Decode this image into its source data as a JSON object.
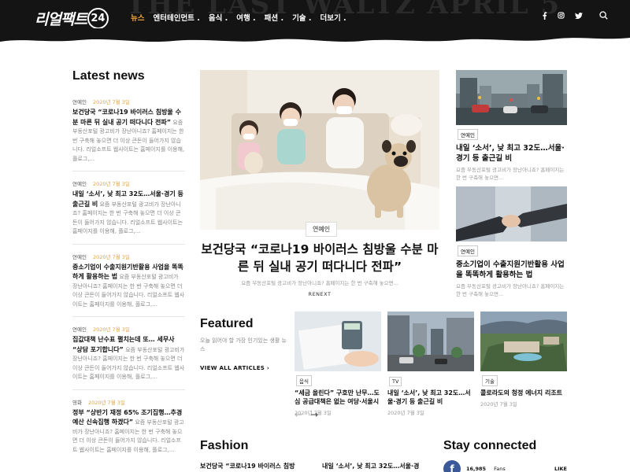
{
  "header": {
    "logo_text": "리얼팩트",
    "logo_num": "24",
    "bg_text": "THE LAST WALTZ APRIL 5",
    "nav": [
      "뉴스",
      "엔터테인먼트 .",
      "음식 .",
      "여행 .",
      "패션 .",
      "기술 .",
      "더보기 ."
    ],
    "active_nav": 0,
    "social_icons": [
      "facebook-icon",
      "instagram-icon",
      "twitter-icon",
      "search-icon"
    ]
  },
  "latest": {
    "title": "Latest news",
    "items": [
      {
        "category": "연예인",
        "date": "2020년 7월 3일",
        "title": "보건당국 “코로나19 바이러스 침방울 수분 마른 뒤 실내 공기 떠다니다 전파”",
        "excerpt": "요즘 부동산포털 광고비가 장난아니죠? 홈페이지는 한 번 구축해 놓으면 더 이상 큰돈이 들어가지 않습니다. 리얼소프트 웹사이트는 홈페이지를 이용해, 플로그,..."
      },
      {
        "category": "연예인",
        "date": "2020년 7월 3일",
        "title": "내일 ‘소서’, 낮 최고 32도…서울·경기 등 출근길 비",
        "excerpt": "요즘 부동산포털 광고비가 장난아니죠? 홈페이지는 한 번 구축해 놓으면 더 이상 큰돈이 들어가지 않습니다. 리얼소프트 웹사이트는 홈페이지를 이용해, 플로그,..."
      },
      {
        "category": "연예인",
        "date": "2020년 7월 3일",
        "title": "중소기업이 수출지원기반활용 사업을 똑똑하게 활용하는 법",
        "excerpt": "요즘 부동산포털 광고비가 장난아니죠? 홈페이지는 한 번 구축해 놓으면 더 이상 큰돈이 들어가지 않습니다. 리얼소프트 웹사이트는 홈페이지를 이용해, 플로그,..."
      },
      {
        "category": "연예인",
        "date": "2020년 7월 3일",
        "title": "집값대책 난수표 펼치는데 또… 세무사 “상담 포기합니다”",
        "excerpt": "요즘 부동산포털 광고비가 장난아니죠? 홈페이지는 한 번 구축해 놓으면 더 이상 큰돈이 들어가지 않습니다. 리얼소프트 웹사이트는 홈페이지를 이용해, 플로그,..."
      },
      {
        "category": "영화",
        "date": "2020년 7월 3일",
        "title": "정부 “상반기 재정 65% 조기집행…추경예산 신속집행 하겠다”",
        "excerpt": "요즘 부동산포털 광고비가 장난아니죠? 홈페이지는 한 번 구축해 놓으면 더 이상 큰돈이 들어가지 않습니다. 리얼소프트 웹사이트는 홈페이지를 이용해, 플로그,..."
      }
    ]
  },
  "hero": {
    "category": "연예인",
    "title": "보건당국 “코로나19 바이러스 침방울 수분 마른 뒤 실내 공기 떠다니다 전파”",
    "excerpt": "요즘 부동산포털 광고비가 장난아니죠? 홈페이지는 한 번 구축해 놓으면...",
    "source": "RENEXT"
  },
  "right_cards": [
    {
      "category": "연예인",
      "title": "내일 ‘소서’, 낮 최고 32도…서울·경기 등 출근길 비",
      "excerpt": "요즘 부동산포털 광고비가 장난아니죠? 홈페이지는 한 번 구축해 놓으면..."
    },
    {
      "category": "연예인",
      "title": "중소기업이 수출지원기반활용 사업을 똑똑하게 활용하는 법",
      "excerpt": "요즘 부동산포털 광고비가 장난아니죠? 홈페이지는 한 번 구축해 놓으면..."
    }
  ],
  "featured": {
    "title": "Featured",
    "description": "오늘 읽어야 할 가장 인기있는 생활 뉴스",
    "link": "VIEW ALL ARTICLES",
    "cards": [
      {
        "category": "음식",
        "title": "“세금 올린다” 구호만 난무…도심 공급대책은 없는 여당·서울시",
        "date": "2020년 7월 3일"
      },
      {
        "category": "TV",
        "title": "내일 ‘소서’, 낮 최고 32도…서울·경기 등 출근길 비",
        "date": "2020년 7월 3일"
      },
      {
        "category": "기술",
        "title": "콜로라도의 청정 에너지 리조트",
        "date": "2020년 7월 3일"
      }
    ]
  },
  "fashion": {
    "title": "Fashion",
    "items": [
      "보건당국 “코로나19 바이러스 침방",
      "내일 ‘소서’, 낮 최고 32도…서울·경"
    ]
  },
  "stay": {
    "title": "Stay connected",
    "fb_count": "16,985",
    "fb_label": "Fans",
    "fb_action": "LIKE"
  },
  "colors": {
    "accent": "#e2a53a",
    "header_bg": "#141414",
    "facebook": "#3b5998"
  }
}
